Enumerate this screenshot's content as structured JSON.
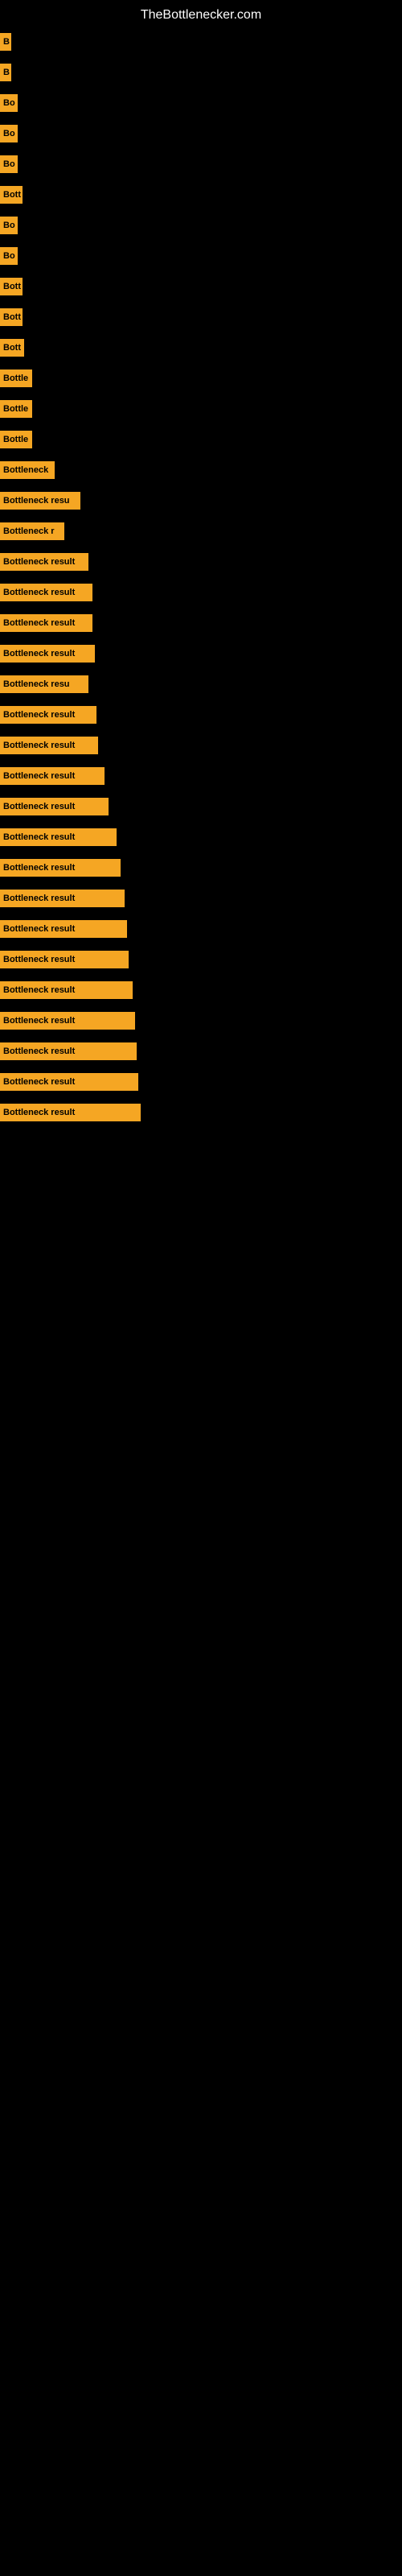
{
  "site": {
    "title": "TheBottlenecker.com"
  },
  "bars": [
    {
      "id": 1,
      "label": "B",
      "width": 14
    },
    {
      "id": 2,
      "label": "B",
      "width": 14
    },
    {
      "id": 3,
      "label": "Bo",
      "width": 22
    },
    {
      "id": 4,
      "label": "Bo",
      "width": 22
    },
    {
      "id": 5,
      "label": "Bo",
      "width": 22
    },
    {
      "id": 6,
      "label": "Bott",
      "width": 28
    },
    {
      "id": 7,
      "label": "Bo",
      "width": 22
    },
    {
      "id": 8,
      "label": "Bo",
      "width": 22
    },
    {
      "id": 9,
      "label": "Bott",
      "width": 28
    },
    {
      "id": 10,
      "label": "Bott",
      "width": 28
    },
    {
      "id": 11,
      "label": "Bott",
      "width": 30
    },
    {
      "id": 12,
      "label": "Bottle",
      "width": 40
    },
    {
      "id": 13,
      "label": "Bottle",
      "width": 40
    },
    {
      "id": 14,
      "label": "Bottle",
      "width": 40
    },
    {
      "id": 15,
      "label": "Bottleneck",
      "width": 68
    },
    {
      "id": 16,
      "label": "Bottleneck resu",
      "width": 100
    },
    {
      "id": 17,
      "label": "Bottleneck r",
      "width": 80
    },
    {
      "id": 18,
      "label": "Bottleneck result",
      "width": 110
    },
    {
      "id": 19,
      "label": "Bottleneck result",
      "width": 115
    },
    {
      "id": 20,
      "label": "Bottleneck result",
      "width": 115
    },
    {
      "id": 21,
      "label": "Bottleneck result",
      "width": 118
    },
    {
      "id": 22,
      "label": "Bottleneck resu",
      "width": 110
    },
    {
      "id": 23,
      "label": "Bottleneck result",
      "width": 120
    },
    {
      "id": 24,
      "label": "Bottleneck result",
      "width": 122
    },
    {
      "id": 25,
      "label": "Bottleneck result",
      "width": 130
    },
    {
      "id": 26,
      "label": "Bottleneck result",
      "width": 135
    },
    {
      "id": 27,
      "label": "Bottleneck result",
      "width": 145
    },
    {
      "id": 28,
      "label": "Bottleneck result",
      "width": 150
    },
    {
      "id": 29,
      "label": "Bottleneck result",
      "width": 155
    },
    {
      "id": 30,
      "label": "Bottleneck result",
      "width": 158
    },
    {
      "id": 31,
      "label": "Bottleneck result",
      "width": 160
    },
    {
      "id": 32,
      "label": "Bottleneck result",
      "width": 165
    },
    {
      "id": 33,
      "label": "Bottleneck result",
      "width": 168
    },
    {
      "id": 34,
      "label": "Bottleneck result",
      "width": 170
    },
    {
      "id": 35,
      "label": "Bottleneck result",
      "width": 172
    },
    {
      "id": 36,
      "label": "Bottleneck result",
      "width": 175
    }
  ]
}
